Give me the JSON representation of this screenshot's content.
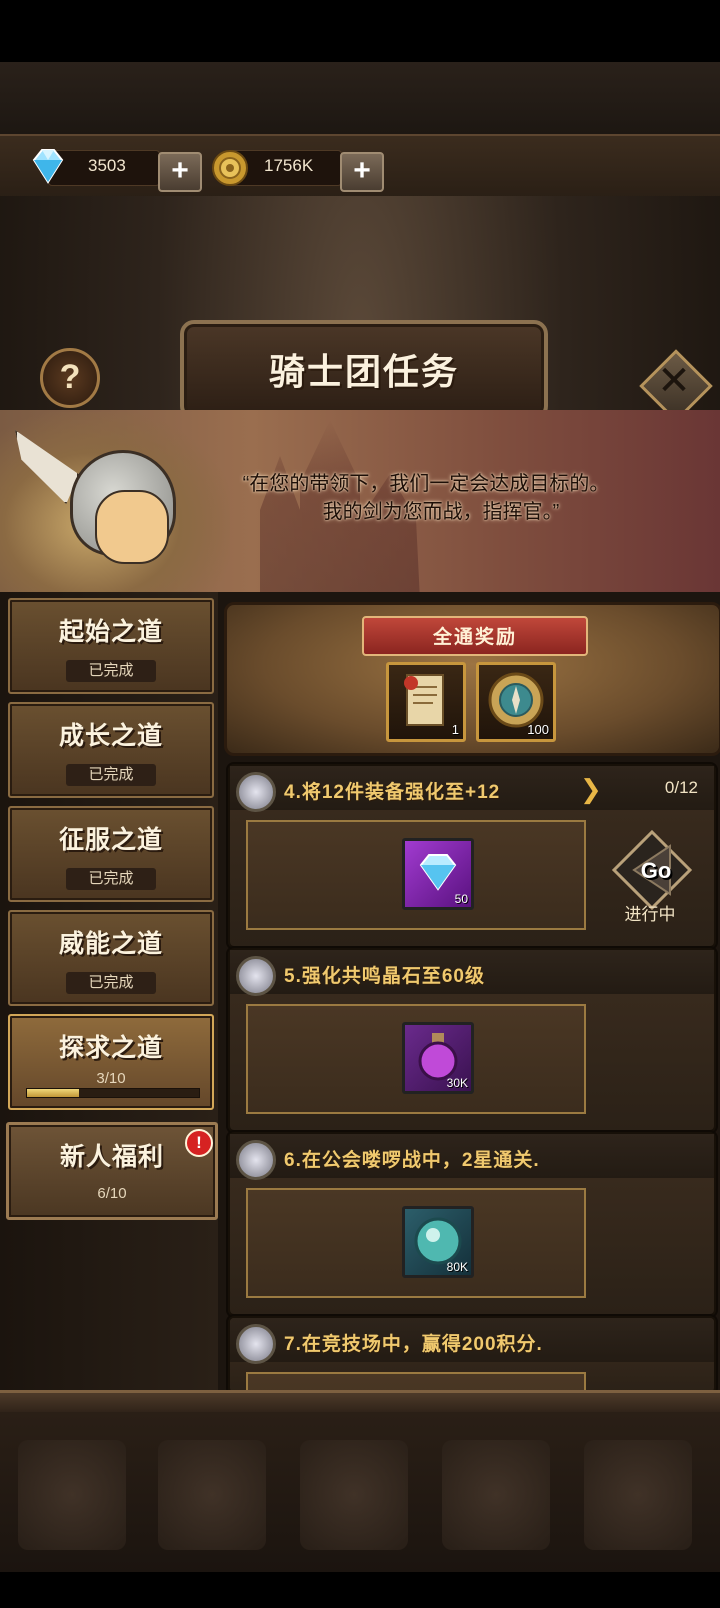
{
  "currency": {
    "gems": {
      "icon": "diamond-icon",
      "value": "3503"
    },
    "gold": {
      "icon": "gold-coin-icon",
      "value": "1756K"
    }
  },
  "header": {
    "title": "骑士团任务",
    "help_label": "?",
    "close_icon": "close-icon"
  },
  "story": {
    "quote_line1": "“在您的带领下，我们一定会达成目标的。",
    "quote_line2": "我的剑为您而战，指挥官。”"
  },
  "sidebar": {
    "items": [
      {
        "name": "起始之道",
        "status": "已完成"
      },
      {
        "name": "成长之道",
        "status": "已完成"
      },
      {
        "name": "征服之道",
        "status": "已完成"
      },
      {
        "name": "威能之道",
        "status": "已完成"
      },
      {
        "name": "探求之道",
        "progress": "3/10",
        "progress_fraction": 0.3
      },
      {
        "name": "新人福利",
        "progress": "6/10",
        "alert": "!"
      }
    ]
  },
  "all_clear": {
    "title": "全通奖励",
    "items": [
      {
        "icon": "scroll-icon",
        "count": "1"
      },
      {
        "icon": "compass-icon",
        "count": "100"
      }
    ]
  },
  "tasks": [
    {
      "title": "4.将12件装备强化至+12",
      "progress": "0/12",
      "reward_icon": "diamond-icon",
      "reward_amount": "50",
      "reward_color": "#7a1fa0",
      "button": "Go",
      "status": "进行中"
    },
    {
      "title": "5.强化共鸣晶石至60级",
      "reward_icon": "potion-icon",
      "reward_amount": "30K",
      "reward_color": "#5a1f7a"
    },
    {
      "title": "6.在公会喽啰战中，2星通关.",
      "reward_icon": "orb-icon",
      "reward_amount": "80K",
      "reward_color": "#1f4a5a"
    },
    {
      "title": "7.在竞技场中，赢得200积分."
    }
  ]
}
